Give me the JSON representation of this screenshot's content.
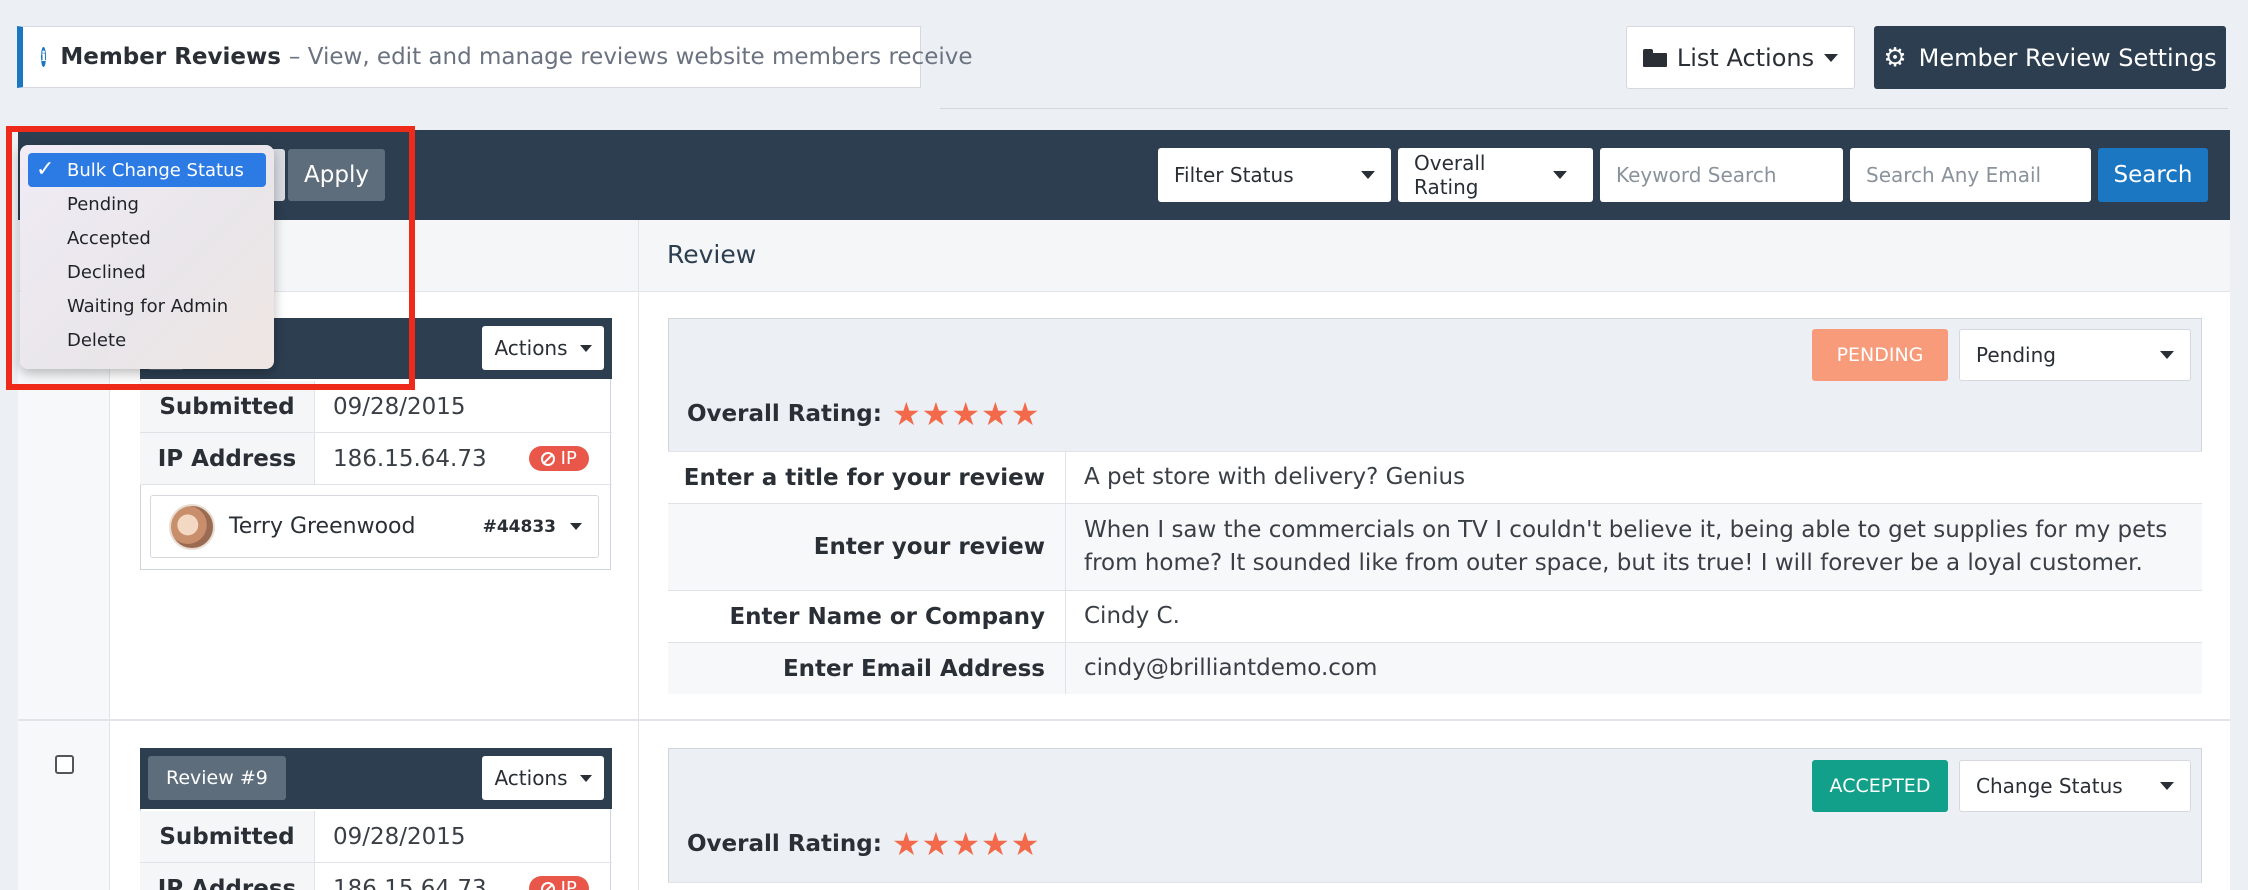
{
  "header": {
    "title": "Member Reviews",
    "description": "– View, edit and manage reviews website members receive",
    "list_actions_label": "List Actions",
    "settings_label": "Member Review Settings"
  },
  "toolbar": {
    "apply_label": "Apply",
    "filter_status": "Filter Status",
    "overall_rating": "Overall Rating",
    "keyword_placeholder": "Keyword Search",
    "email_placeholder": "Search Any Email",
    "search_label": "Search"
  },
  "bulk_menu": {
    "items": [
      "Bulk Change Status",
      "Pending",
      "Accepted",
      "Declined",
      "Waiting for Admin",
      "Delete"
    ]
  },
  "table": {
    "review_header": "Review"
  },
  "reviews": [
    {
      "actions_label": "Actions",
      "submitted_label": "Submitted",
      "submitted": "09/28/2015",
      "ip_label": "IP Address",
      "ip": "186.15.64.73",
      "ip_badge": "IP",
      "member_name": "Terry Greenwood",
      "member_id": "#44833",
      "status_badge": "PENDING",
      "status_select": "Pending",
      "overall_label": "Overall Rating:",
      "rating": 5,
      "stars": "★★★★★",
      "fields": [
        {
          "key": "Enter a title for your review",
          "value": "A pet store with delivery? Genius"
        },
        {
          "key": "Enter your review",
          "value": "When I saw the commercials on TV I couldn't believe it, being able to get supplies for my pets from home? It sounded like from outer space, but its true! I will forever be a loyal customer."
        },
        {
          "key": "Enter Name or Company",
          "value": "Cindy C."
        },
        {
          "key": "Enter Email Address",
          "value": "cindy@brilliantdemo.com"
        }
      ]
    },
    {
      "badge": "Review #9",
      "actions_label": "Actions",
      "submitted_label": "Submitted",
      "submitted": "09/28/2015",
      "ip_label": "IP Address",
      "ip": "186.15.64.73",
      "ip_badge": "IP",
      "status_badge": "ACCEPTED",
      "status_select": "Change Status",
      "overall_label": "Overall Rating:",
      "rating": 5,
      "stars": "★★★★★"
    }
  ],
  "colors": {
    "navy": "#2c3e50",
    "accent_blue": "#1c77c3",
    "pending": "#f79b7b",
    "accepted": "#12a08a",
    "star": "#f26a4b",
    "highlight": "#ee2b1b"
  }
}
